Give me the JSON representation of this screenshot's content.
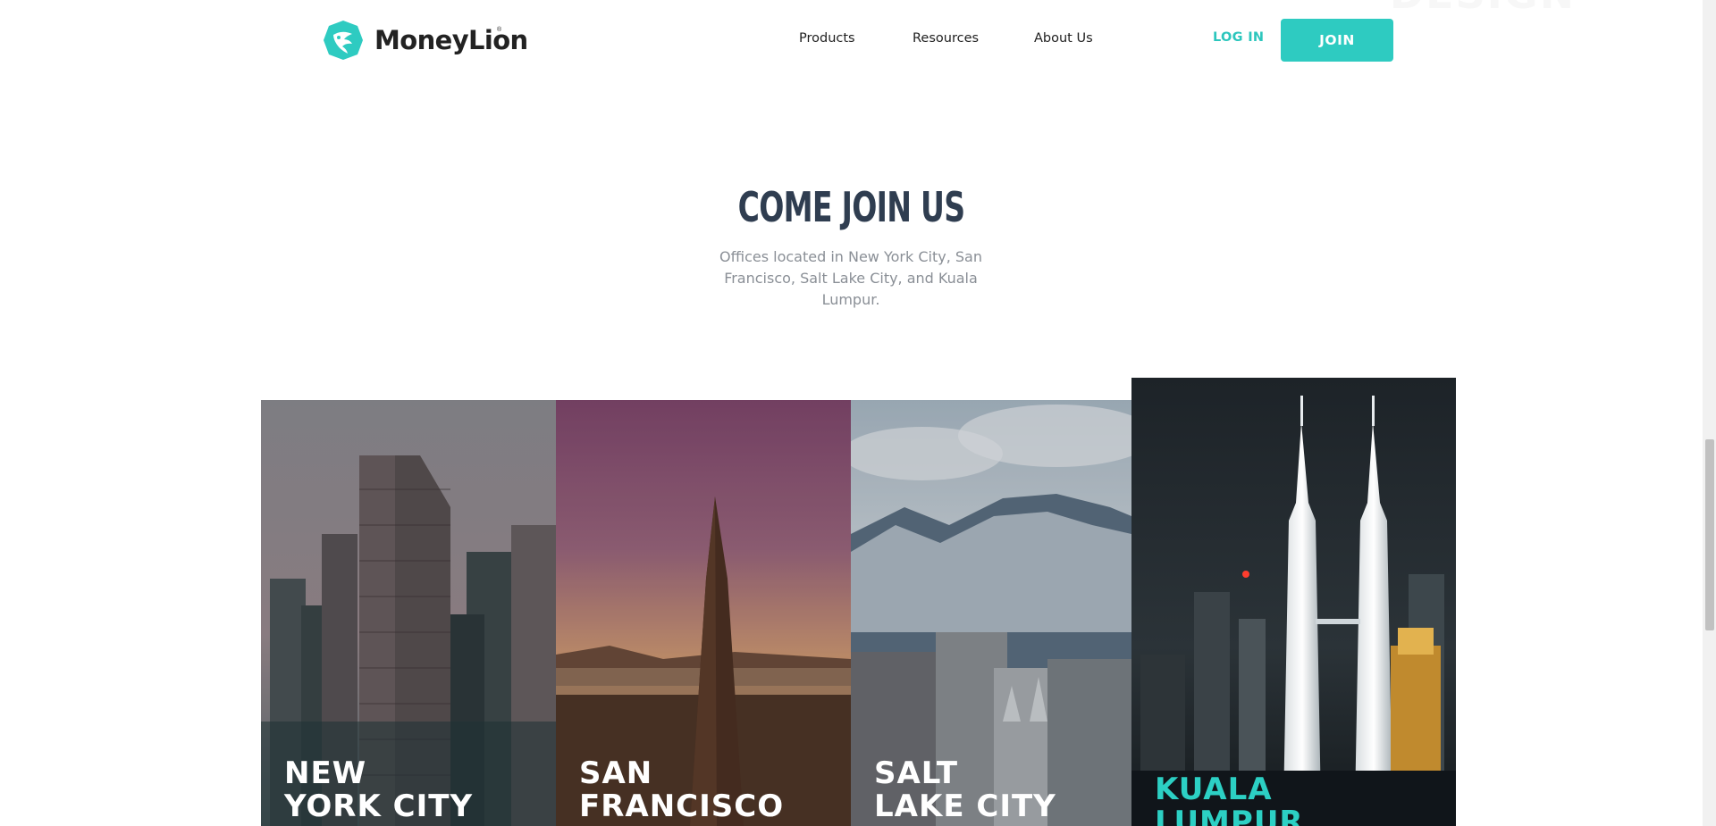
{
  "header": {
    "brand": "MoneyLion",
    "nav": [
      "Products",
      "Resources",
      "About Us"
    ],
    "login_label": "LOG IN",
    "join_label": "JOIN"
  },
  "intro": {
    "title": "COME JOIN US",
    "subtitle": "Offices located in New York City, San Francisco, Salt Lake City, and Kuala Lumpur."
  },
  "cities": [
    {
      "line1": "NEW",
      "line2": "YORK CITY",
      "active": false
    },
    {
      "line1": "SAN",
      "line2": "FRANCISCO",
      "active": false
    },
    {
      "line1": "SALT",
      "line2": "LAKE CITY",
      "active": false
    },
    {
      "line1": "KUALA",
      "line2": "LUMPUR",
      "active": true
    }
  ],
  "colors": {
    "brand_teal": "#2ecbc1",
    "heading": "#2f3d50",
    "body_text": "#8a8f96"
  }
}
